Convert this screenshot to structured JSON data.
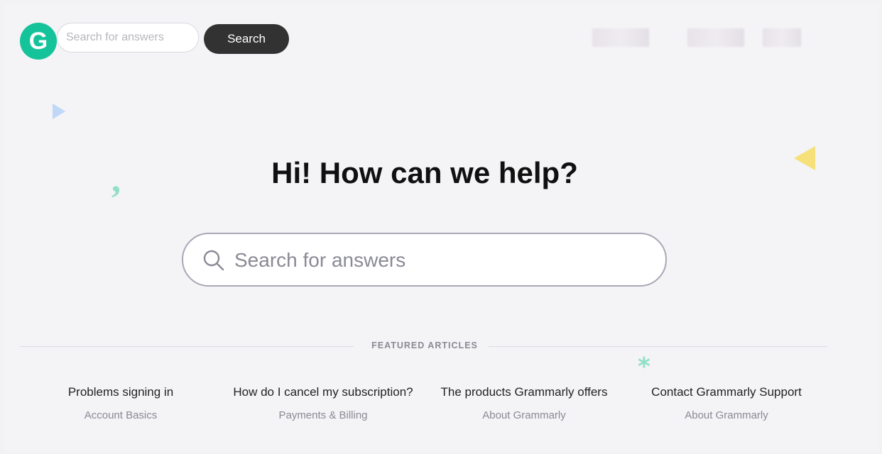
{
  "header": {
    "logo_letter": "G",
    "search_placeholder": "Search for answers",
    "search_button_label": "Search"
  },
  "hero": {
    "title": "Hi! How can we help?",
    "search_placeholder": "Search for answers"
  },
  "featured": {
    "label": "FEATURED ARTICLES",
    "articles": [
      {
        "title": "Problems signing in",
        "category": "Account Basics"
      },
      {
        "title": "How do I cancel my subscription?",
        "category": "Payments & Billing"
      },
      {
        "title": "The products Grammarly offers",
        "category": "About Grammarly"
      },
      {
        "title": "Contact Grammarly Support",
        "category": "About Grammarly"
      }
    ]
  },
  "colors": {
    "brand_green": "#15c39a",
    "button_dark": "#333233",
    "accent_mint": "#8fe0c5",
    "accent_yellow": "#f5e07a",
    "accent_blue": "#bfd8f7"
  }
}
